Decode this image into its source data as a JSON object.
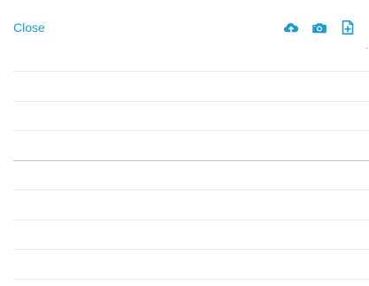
{
  "header": {
    "close_label": "Close",
    "accent_color": "#1d9bd1",
    "tools": [
      {
        "name": "cloud-upload-icon"
      },
      {
        "name": "camera-icon"
      },
      {
        "name": "file-add-icon"
      }
    ]
  },
  "list": {
    "row_count": 8
  }
}
